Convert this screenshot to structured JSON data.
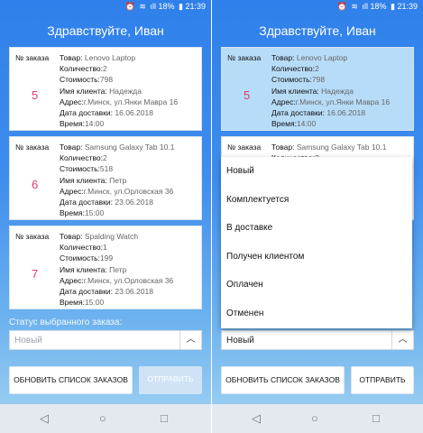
{
  "status_bar": {
    "time": "21:39",
    "battery": "18%",
    "signal": "ıll"
  },
  "greeting": "Здравствуйте, Иван",
  "orders": [
    {
      "order_label": "№ заказа",
      "number": "5",
      "fields": [
        {
          "label": "Товар:",
          "value": "Lenovo Laptop"
        },
        {
          "label": "Количество:",
          "value": "2"
        },
        {
          "label": "Стоимость:",
          "value": "798"
        },
        {
          "label": "Имя клиента:",
          "value": "Надежда"
        },
        {
          "label": "Адрес:",
          "value": "г.Минск, ул.Янки Мавра 16"
        },
        {
          "label": "Дата доставки:",
          "value": "16.06.2018"
        },
        {
          "label": "Время:",
          "value": "14:00"
        }
      ]
    },
    {
      "order_label": "№ заказа",
      "number": "6",
      "fields": [
        {
          "label": "Товар:",
          "value": "Samsung Galaxy Tab 10.1"
        },
        {
          "label": "Количество:",
          "value": "2"
        },
        {
          "label": "Стоимость:",
          "value": "518"
        },
        {
          "label": "Имя клиента:",
          "value": "Петр"
        },
        {
          "label": "Адрес:",
          "value": "г.Минск, ул.Орловская 36"
        },
        {
          "label": "Дата доставки:",
          "value": "23.06.2018"
        },
        {
          "label": "Время:",
          "value": "15:00"
        }
      ]
    },
    {
      "order_label": "№ заказа",
      "number": "7",
      "fields": [
        {
          "label": "Товар:",
          "value": "Spalding Watch"
        },
        {
          "label": "Количество:",
          "value": "1"
        },
        {
          "label": "Стоимость:",
          "value": "199"
        },
        {
          "label": "Имя клиента:",
          "value": "Петр"
        },
        {
          "label": "Адрес:",
          "value": "г.Минск, ул.Орловская 36"
        },
        {
          "label": "Дата доставки:",
          "value": "23.06.2018"
        },
        {
          "label": "Время:",
          "value": "15:00"
        }
      ]
    }
  ],
  "status_label": "Статус выбранного заказа:",
  "status_selected": "Новый",
  "status_options": [
    "Новый",
    "Комплектуется",
    "В доставке",
    "Получен клиентом",
    "Оплачен",
    "Отменен"
  ],
  "buttons": {
    "refresh": "ОБНОВИТЬ СПИСОК ЗАКАЗОВ",
    "send": "ОТПРАВИТЬ"
  },
  "icons": {
    "chevron": "chevron-up-icon",
    "nav_back": "back-triangle-icon",
    "nav_home": "home-circle-icon",
    "nav_recent": "recent-square-icon"
  },
  "colors": {
    "accent": "#2f80ea",
    "order_number": "#e0386b",
    "selected_card": "#b7dcf8"
  }
}
